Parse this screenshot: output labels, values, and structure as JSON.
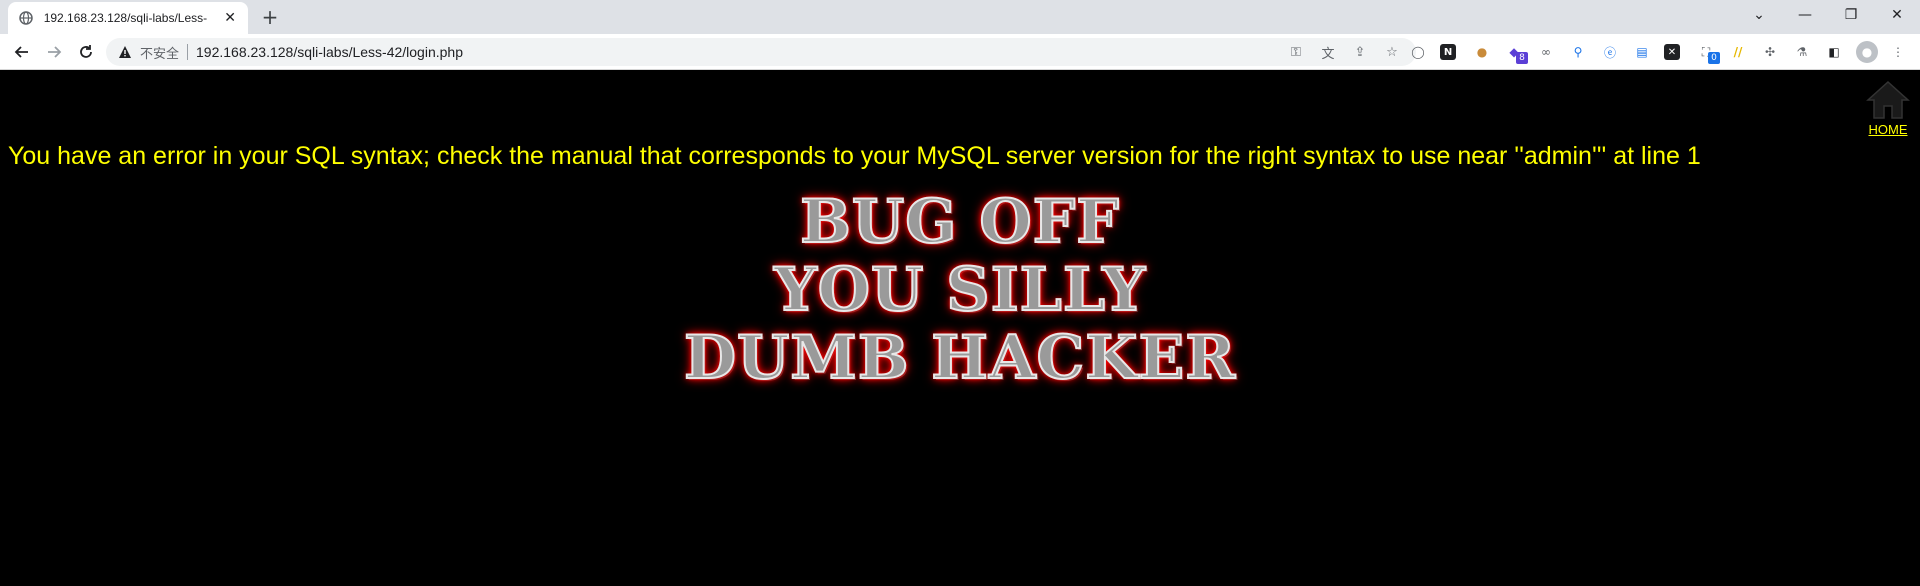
{
  "browser": {
    "tab_title": "192.168.23.128/sqli-labs/Less-",
    "new_tab_label": "+",
    "security_label": "不安全",
    "url": "192.168.23.128/sqli-labs/Less-42/login.php",
    "extension_badges": {
      "badge_8": "8",
      "badge_0": "0"
    }
  },
  "page": {
    "home_link": "HOME",
    "error_message": "You have an error in your SQL syntax; check the manual that corresponds to your MySQL server version for the right syntax to use near ''admin''' at line 1",
    "banner_lines": [
      "BUG OFF",
      "YOU SILLY",
      "DUMB HACKER"
    ]
  },
  "colors": {
    "error_text": "#ffff00",
    "background": "#000000",
    "glow": "#ff0000"
  }
}
